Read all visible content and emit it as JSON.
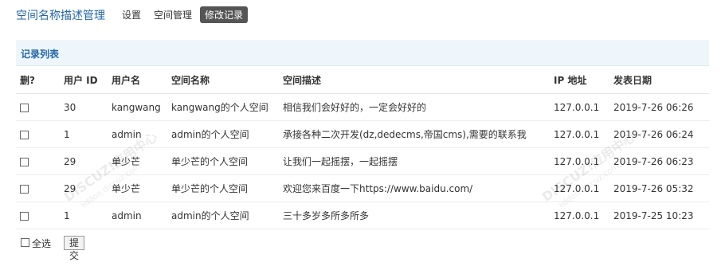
{
  "header": {
    "app_title": "空间名称描述管理",
    "nav": [
      {
        "label": "设置",
        "active": false
      },
      {
        "label": "空间管理",
        "active": false
      },
      {
        "label": "修改记录",
        "active": true
      }
    ]
  },
  "section": {
    "title": "记录列表"
  },
  "table": {
    "columns": [
      "删?",
      "用户 ID",
      "用户名",
      "空间名称",
      "空间描述",
      "IP 地址",
      "发表日期"
    ],
    "rows": [
      {
        "uid": "30",
        "username": "kangwang",
        "space_name": "kangwang的个人空间",
        "space_desc": "相信我们会好好的，一定会好好的",
        "ip": "127.0.0.1",
        "date": "2019-7-26 06:26"
      },
      {
        "uid": "1",
        "username": "admin",
        "space_name": "admin的个人空间",
        "space_desc": "承接各种二次开发(dz,dedecms,帝国cms),需要的联系我",
        "ip": "127.0.0.1",
        "date": "2019-7-26 06:24"
      },
      {
        "uid": "29",
        "username": "单少芒",
        "space_name": "单少芒的个人空间",
        "space_desc": "让我们一起摇摆，一起摇摆",
        "ip": "127.0.0.1",
        "date": "2019-7-26 06:23"
      },
      {
        "uid": "29",
        "username": "单少芒",
        "space_name": "单少芒的个人空间",
        "space_desc": "欢迎您来百度一下https://www.baidu.com/",
        "ip": "127.0.0.1",
        "date": "2019-7-26 05:32"
      },
      {
        "uid": "1",
        "username": "admin",
        "space_name": "admin的个人空间",
        "space_desc": "三十多岁多所多所多",
        "ip": "127.0.0.1",
        "date": "2019-7-25 10:23"
      }
    ]
  },
  "footer": {
    "select_all_label": "全选",
    "submit_label": "提交"
  },
  "watermark": {
    "text": "DISCUZ!应用中心",
    "subtext": "addon.discuz.com"
  }
}
